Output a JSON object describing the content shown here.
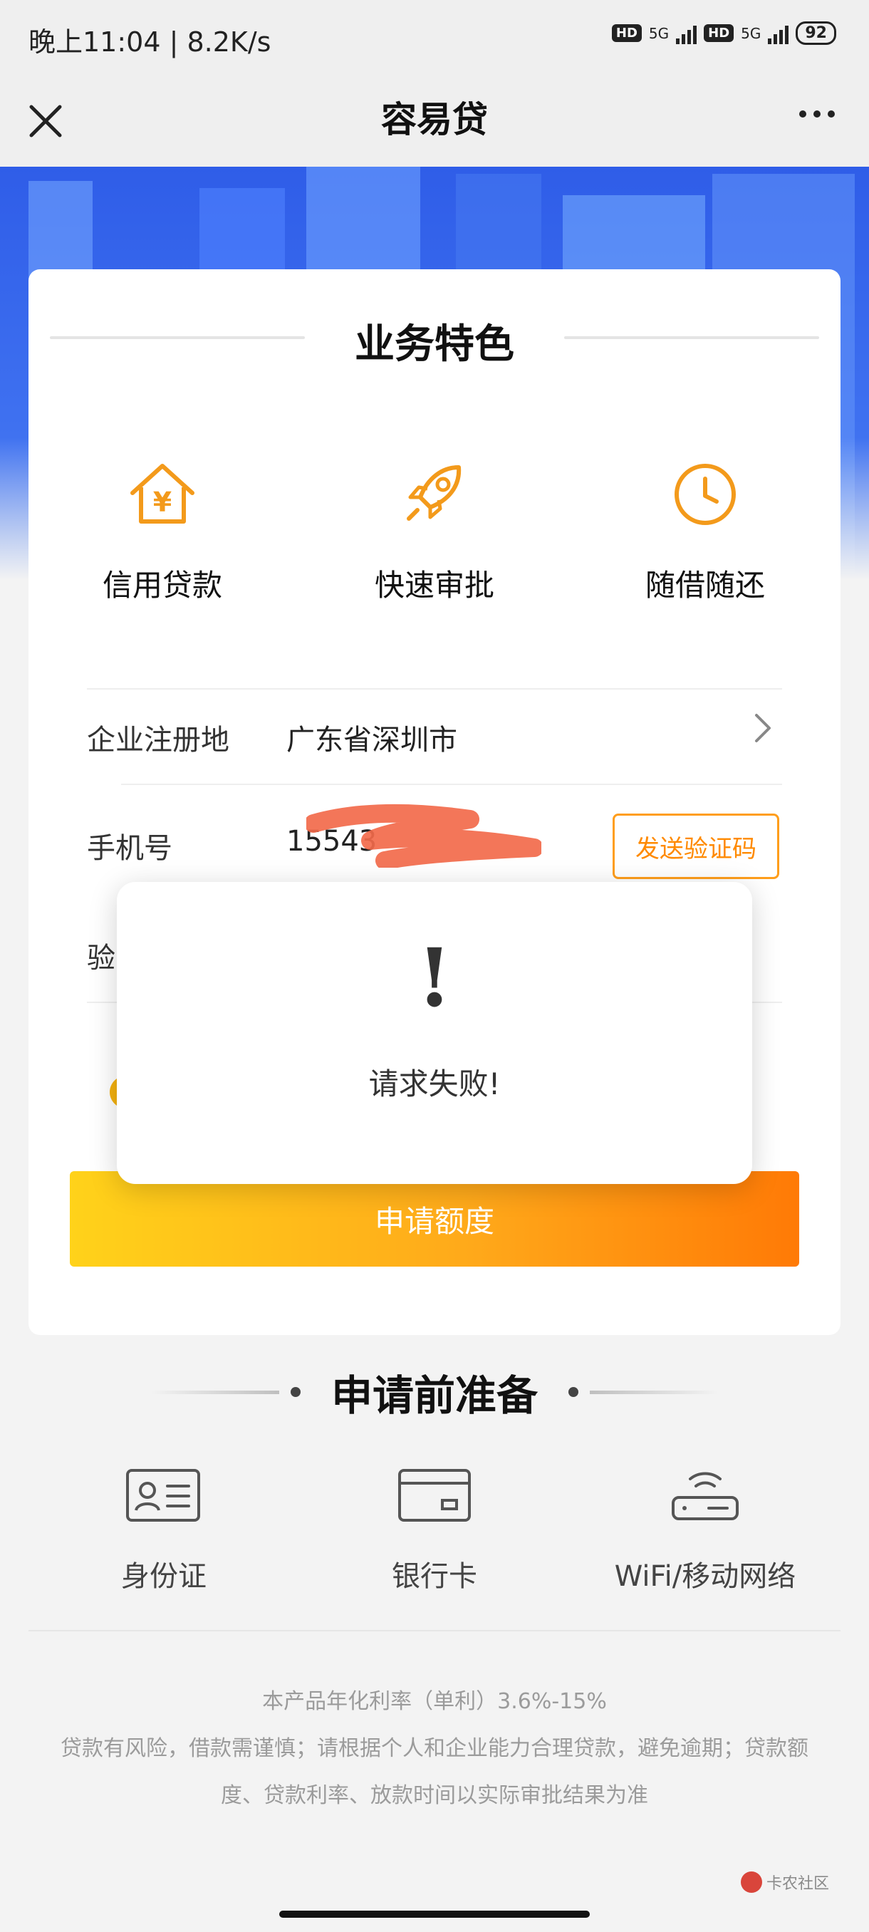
{
  "status_bar": {
    "time_speed": "晚上11:04 | 8.2K/s",
    "hd": "HD",
    "network": "5G",
    "battery": "92"
  },
  "nav": {
    "title": "容易贷"
  },
  "features": {
    "title": "业务特色",
    "items": [
      {
        "label": "信用贷款",
        "icon": "house-yuan-icon"
      },
      {
        "label": "快速审批",
        "icon": "rocket-icon"
      },
      {
        "label": "随借随还",
        "icon": "clock-icon"
      }
    ]
  },
  "form": {
    "region_label": "企业注册地",
    "region_value": "广东省深圳市",
    "phone_label": "手机号",
    "phone_value": "15543",
    "send_code_label": "发送验证码",
    "code_label_partial": "验"
  },
  "apply_button": "申请额度",
  "modal": {
    "mark": "!",
    "message": "请求失败!"
  },
  "prep": {
    "title": "申请前准备",
    "items": [
      {
        "label": "身份证",
        "icon": "id-card-icon"
      },
      {
        "label": "银行卡",
        "icon": "bank-card-icon"
      },
      {
        "label": "WiFi/移动网络",
        "icon": "router-icon"
      }
    ]
  },
  "footer": {
    "line1": "本产品年化利率（单利）3.6%-15%",
    "line2": "贷款有风险，借款需谨慎；请根据个人和企业能力合理贷款，避免逾期；贷款额",
    "line3": "度、贷款利率、放款时间以实际审批结果为准"
  },
  "watermark": "卡农社区",
  "colors": {
    "accent_orange": "#ff9e1b",
    "banner_blue": "#3e70f0",
    "apply_gradient_start": "#ffd21a",
    "apply_gradient_end": "#ff7a06"
  }
}
